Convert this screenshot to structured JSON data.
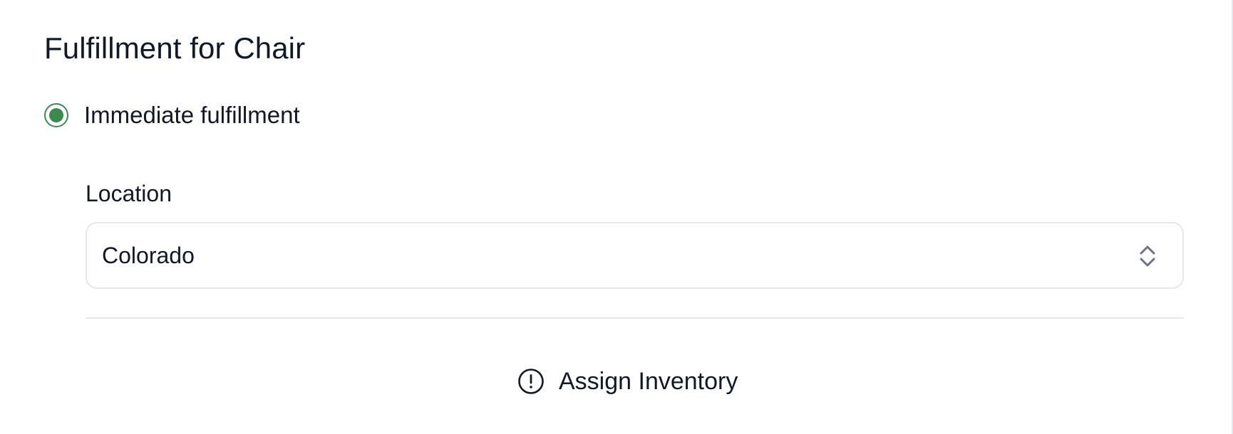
{
  "section": {
    "title": "Fulfillment for Chair"
  },
  "fulfillment_option": {
    "label": "Immediate fulfillment",
    "selected": true,
    "accent_color": "#3d8a4e"
  },
  "location": {
    "label": "Location",
    "selected_value": "Colorado",
    "icon": "chevron-up-down-icon"
  },
  "assign_inventory": {
    "label": "Assign Inventory",
    "icon": "alert-circle-icon"
  }
}
